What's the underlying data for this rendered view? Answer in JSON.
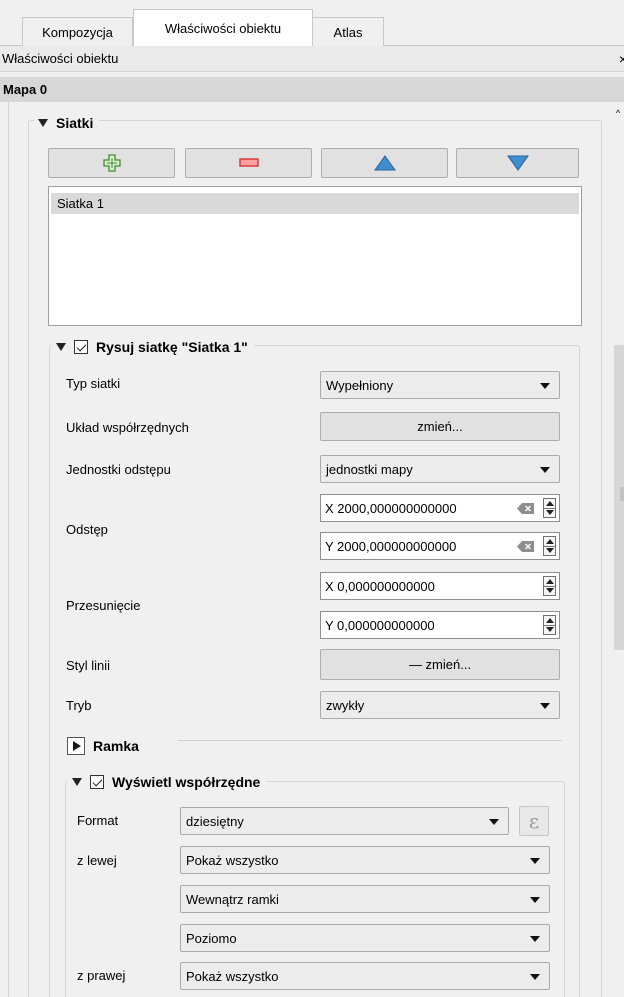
{
  "tabs": [
    "Kompozycja",
    "Właściwości obiektu",
    "Atlas"
  ],
  "dock": {
    "title": "Właściwości obiektu",
    "close_glyph": "×"
  },
  "item": {
    "title": "Mapa 0"
  },
  "grids": {
    "title": "Siatki",
    "buttons": {
      "add": "add-grid-icon",
      "remove": "remove-grid-icon",
      "up": "move-up-icon",
      "down": "move-down-icon"
    },
    "list_items": [
      "Siatka 1"
    ]
  },
  "draw_grid": {
    "title": "Rysuj siatkę \"Siatka 1\"",
    "checked": true,
    "labels": {
      "grid_type": "Typ siatki",
      "crs": "Układ współrzędnych",
      "interval_units": "Jednostki odstępu",
      "interval": "Odstęp",
      "offset": "Przesunięcie",
      "line_style": "Styl linii",
      "blend_mode": "Tryb"
    },
    "values": {
      "grid_type": "Wypełniony",
      "crs_button": "zmień...",
      "interval_units": "jednostki mapy",
      "interval_x": "X 2000,000000000000",
      "interval_y": "Y 2000,000000000000",
      "offset_x": "X 0,000000000000",
      "offset_y": "Y 0,000000000000",
      "line_style_button": "— zmień...",
      "blend_mode": "zwykły"
    }
  },
  "frame": {
    "title": "Ramka"
  },
  "coordinates": {
    "title": "Wyświetl współrzędne",
    "checked": true,
    "labels": {
      "format": "Format",
      "left": "z lewej",
      "right": "z prawej"
    },
    "values": {
      "format": "dziesiętny",
      "expression_glyph": "ε",
      "left_display": "Pokaż wszystko",
      "left_position": "Wewnątrz ramki",
      "left_direction": "Poziomo",
      "right_display": "Pokaż wszystko"
    }
  }
}
